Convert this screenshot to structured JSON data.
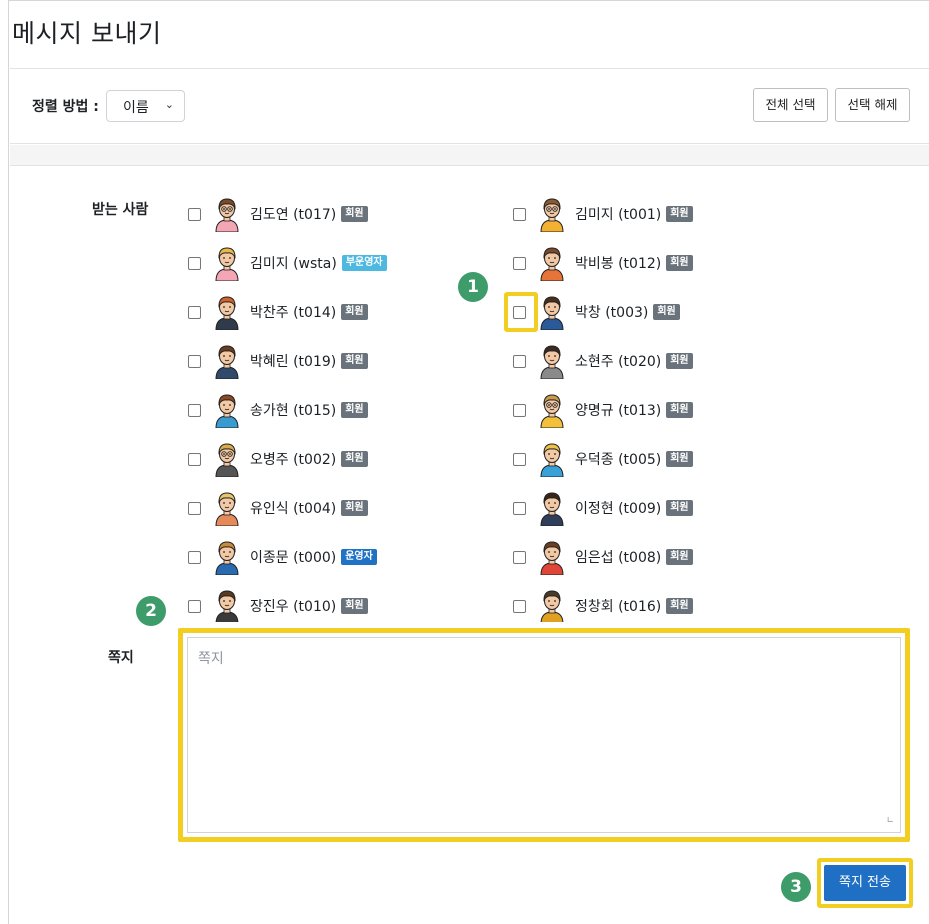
{
  "page": {
    "title": "메시지 보내기"
  },
  "sort": {
    "label": "정렬 방법 :",
    "selected": "이름"
  },
  "toolbar": {
    "select_all_label": "전체 선택",
    "deselect_label": "선택 해제"
  },
  "form": {
    "recipients_label": "받는 사람",
    "memo_label": "쪽지",
    "memo_placeholder": "쪽지",
    "send_label": "쪽지 전송"
  },
  "steps": [
    "1",
    "2",
    "3"
  ],
  "badges": {
    "member": "회원",
    "assistant": "부운영자",
    "admin": "운영자"
  },
  "recipients_left": [
    {
      "name": "김도연 (t017)",
      "role": "회원",
      "role_type": "member",
      "avatar": "woman-glasses-icon"
    },
    {
      "name": "김미지 (wsta)",
      "role": "부운영자",
      "role_type": "assistant",
      "avatar": "woman-blonde-icon"
    },
    {
      "name": "박찬주 (t014)",
      "role": "회원",
      "role_type": "member",
      "avatar": "woman-redhead-icon"
    },
    {
      "name": "박혜린 (t019)",
      "role": "회원",
      "role_type": "member",
      "avatar": "man-beard-icon"
    },
    {
      "name": "송가현 (t015)",
      "role": "회원",
      "role_type": "member",
      "avatar": "woman-longhair-icon"
    },
    {
      "name": "오병주 (t002)",
      "role": "회원",
      "role_type": "member",
      "avatar": "woman-glasses-gray-icon"
    },
    {
      "name": "유인식 (t004)",
      "role": "회원",
      "role_type": "member",
      "avatar": "woman-blonde-tank-icon"
    },
    {
      "name": "이종문 (t000)",
      "role": "운영자",
      "role_type": "admin",
      "avatar": "man-blue-shirt-icon"
    },
    {
      "name": "장진우 (t010)",
      "role": "회원",
      "role_type": "member",
      "avatar": "man-round-icon"
    }
  ],
  "recipients_right": [
    {
      "name": "김미지 (t001)",
      "role": "회원",
      "role_type": "member",
      "avatar": "man-glasses-yellow-icon"
    },
    {
      "name": "박비봉 (t012)",
      "role": "회원",
      "role_type": "member",
      "avatar": "man-orange-icon"
    },
    {
      "name": "박창 (t003)",
      "role": "회원",
      "role_type": "member",
      "avatar": "woman-ponytail-icon"
    },
    {
      "name": "소현주 (t020)",
      "role": "회원",
      "role_type": "member",
      "avatar": "woman-dark-hair-icon"
    },
    {
      "name": "양명규 (t013)",
      "role": "회원",
      "role_type": "member",
      "avatar": "man-glasses-icon"
    },
    {
      "name": "우덕종 (t005)",
      "role": "회원",
      "role_type": "member",
      "avatar": "woman-blonde-blue-icon"
    },
    {
      "name": "이정현 (t009)",
      "role": "회원",
      "role_type": "member",
      "avatar": "man-beard-dark-icon"
    },
    {
      "name": "임은섭 (t008)",
      "role": "회원",
      "role_type": "member",
      "avatar": "man-red-shirt-icon"
    },
    {
      "name": "정창회 (t016)",
      "role": "회원",
      "role_type": "member",
      "avatar": "woman-curly-icon"
    }
  ],
  "colors": {
    "highlight": "#f2cd22",
    "step": "#3e9b6a",
    "send": "#1f6fc4",
    "member_badge": "#6a737b",
    "assistant_badge": "#4db8e0",
    "admin_badge": "#1f72c4"
  }
}
